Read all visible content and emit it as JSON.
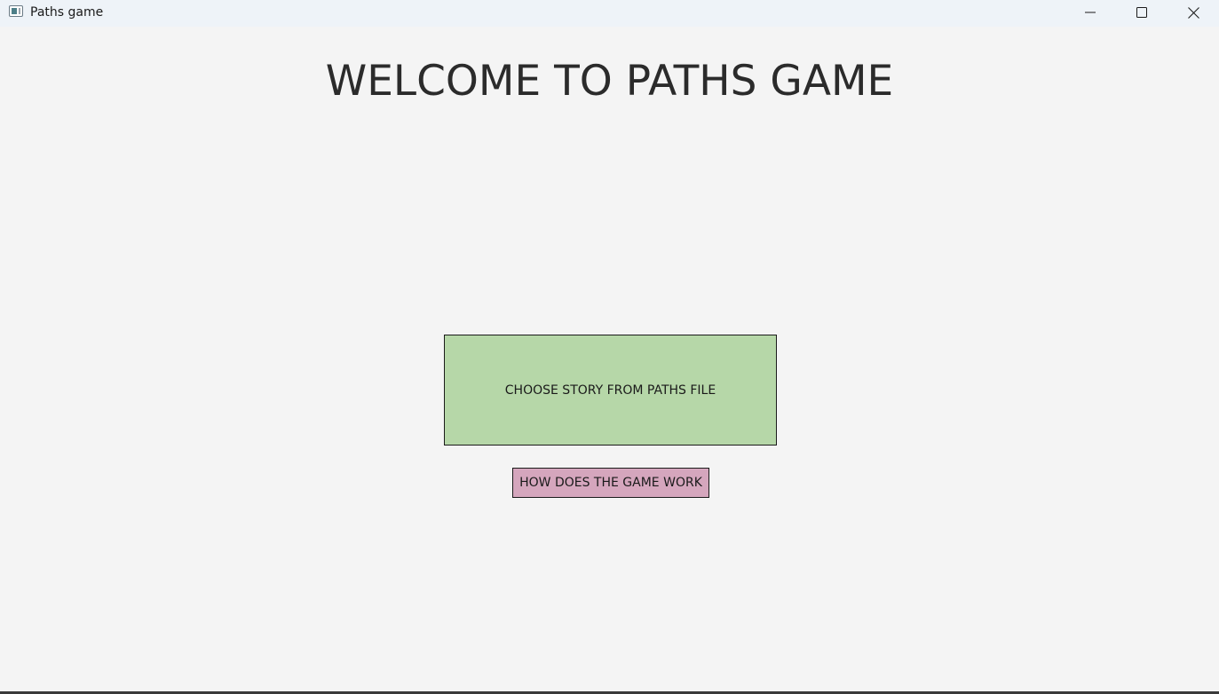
{
  "window": {
    "title": "Paths game",
    "icon": "app-window-icon",
    "controls": {
      "minimize_icon": "minimize-icon",
      "maximize_icon": "maximize-icon",
      "close_icon": "close-icon"
    }
  },
  "main": {
    "heading": "WELCOME TO PATHS GAME",
    "choose_story_button": "CHOOSE STORY FROM PATHS FILE",
    "how_it_works_button": "HOW DOES THE GAME WORK"
  },
  "colors": {
    "background": "#f4f4f4",
    "titlebar": "#eef3f8",
    "choose_button": "#b6d7a8",
    "how_button": "#d5a6bd"
  }
}
